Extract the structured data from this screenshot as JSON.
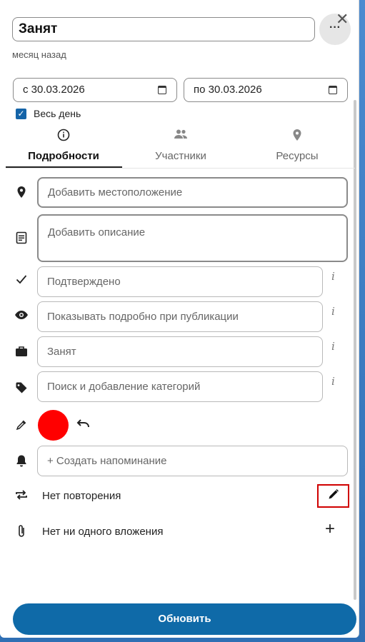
{
  "event": {
    "title": "Занят",
    "modified": "месяц назад",
    "more_label": "···",
    "close_label": "✕"
  },
  "dates": {
    "start": "с 30.03.2026",
    "end": "по 30.03.2026"
  },
  "all_day": {
    "label": "Весь день",
    "checked": true
  },
  "tabs": [
    {
      "label": "Подробности",
      "icon": "info-icon",
      "active": true
    },
    {
      "label": "Участники",
      "icon": "people-icon",
      "active": false
    },
    {
      "label": "Ресурсы",
      "icon": "location-pin-icon",
      "active": false
    }
  ],
  "fields": {
    "location_placeholder": "Добавить местоположение",
    "description_placeholder": "Добавить описание",
    "status_value": "Подтверждено",
    "visibility_value": "Показывать подробно при публикации",
    "busy_value": "Занят",
    "category_placeholder": "Поиск и добавление категорий",
    "reminder_label": "+ Создать напоминание"
  },
  "color": {
    "value": "#ff0000"
  },
  "recurrence": {
    "label": "Нет повторения"
  },
  "attachments": {
    "label": "Нет ни одного вложения"
  },
  "actions": {
    "update_label": "Обновить"
  },
  "info_glyph": "i"
}
